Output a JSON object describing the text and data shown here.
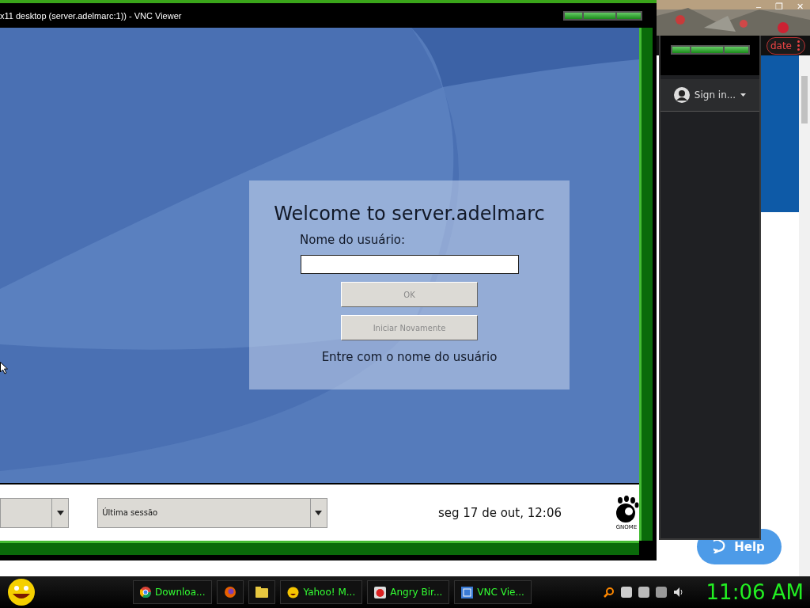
{
  "browser": {
    "window_controls": [
      "–",
      "❐",
      "✕"
    ],
    "update_button": "date",
    "help_button": "Help"
  },
  "chat_window": {
    "sign_in": "Sign in..."
  },
  "vnc_window": {
    "title": "x11 desktop (server.adelmarc:1)) - VNC Viewer"
  },
  "login": {
    "title": "Welcome to server.adelmarc",
    "username_label": "Nome do usuário:",
    "buttons": [
      {
        "label": "OK",
        "disabled": true
      },
      {
        "label": "Iniciar Novamente",
        "disabled": true
      }
    ],
    "hint": "Entre com o nome do usuário"
  },
  "bottom_bar": {
    "session": "Última sessão",
    "clock": "seg 17 de out, 12:06",
    "logo": "GNOME"
  },
  "taskbar": {
    "tasks": [
      {
        "kind": "labeled",
        "label": "Downloa..."
      },
      {
        "kind": "icon"
      },
      {
        "kind": "icon"
      },
      {
        "kind": "labeled",
        "label": "Yahoo! M..."
      },
      {
        "kind": "labeled",
        "label": "Angry Bir..."
      },
      {
        "kind": "labeled",
        "label": "VNC Vie..."
      }
    ],
    "clock": "11:06 AM"
  }
}
